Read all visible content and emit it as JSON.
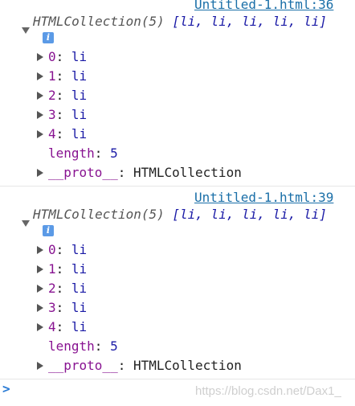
{
  "entries": [
    {
      "source": "Untitled-1.html:36",
      "summary_prefix": "HTMLCollection(5) ",
      "summary_list": "[li, li, li, li, li]",
      "info_glyph": "i",
      "items": [
        {
          "key": "0",
          "value": "li"
        },
        {
          "key": "1",
          "value": "li"
        },
        {
          "key": "2",
          "value": "li"
        },
        {
          "key": "3",
          "value": "li"
        },
        {
          "key": "4",
          "value": "li"
        }
      ],
      "length_key": "length",
      "length_value": "5",
      "proto_key": "__proto__",
      "proto_value": "HTMLCollection"
    },
    {
      "source": "Untitled-1.html:39",
      "summary_prefix": "HTMLCollection(5) ",
      "summary_list": "[li, li, li, li, li]",
      "info_glyph": "i",
      "items": [
        {
          "key": "0",
          "value": "li"
        },
        {
          "key": "1",
          "value": "li"
        },
        {
          "key": "2",
          "value": "li"
        },
        {
          "key": "3",
          "value": "li"
        },
        {
          "key": "4",
          "value": "li"
        }
      ],
      "length_key": "length",
      "length_value": "5",
      "proto_key": "__proto__",
      "proto_value": "HTMLCollection"
    }
  ],
  "prompt_glyph": ">",
  "watermark": "https://blog.csdn.net/Dax1_",
  "colors": {
    "link": "#1a6fa8",
    "key": "#881391",
    "value": "#1a1aa6",
    "info_icon": "#5b9ae6",
    "prompt": "#2a7bd5"
  }
}
